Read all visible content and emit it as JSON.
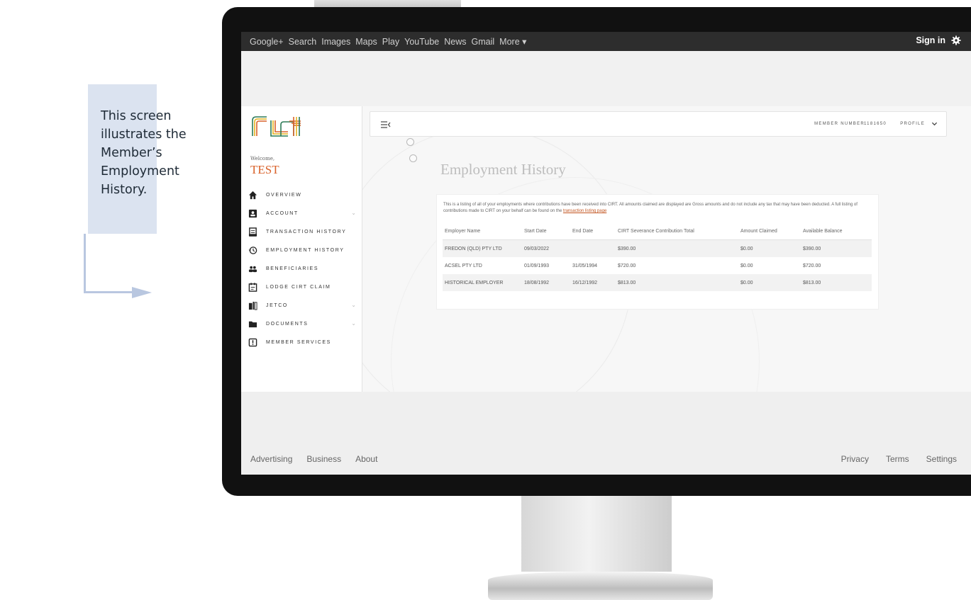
{
  "callout": {
    "text": "This screen illustrates the Member’s Employment History."
  },
  "google_bar": {
    "links": [
      "Google+",
      "Search",
      "Images",
      "Maps",
      "Play",
      "YouTube",
      "News",
      "Gmail",
      "More ▾"
    ],
    "sign_in": "Sign in"
  },
  "sidebar": {
    "welcome": "Welcome,",
    "user_name": "TEST",
    "items": [
      {
        "label": "OVERVIEW",
        "icon": "home-icon"
      },
      {
        "label": "ACCOUNT",
        "icon": "account-icon"
      },
      {
        "label": "TRANSACTION HISTORY",
        "icon": "receipt-icon"
      },
      {
        "label": "EMPLOYMENT HISTORY",
        "icon": "history-icon"
      },
      {
        "label": "BENEFICIARIES",
        "icon": "people-icon"
      },
      {
        "label": "LODGE CIRT CLAIM",
        "icon": "claim-icon"
      },
      {
        "label": "JETCO",
        "icon": "books-icon"
      },
      {
        "label": "DOCUMENTS",
        "icon": "folder-icon"
      },
      {
        "label": "MEMBER SERVICES",
        "icon": "services-icon"
      }
    ]
  },
  "header": {
    "member_label": "MEMBER NUMBER:",
    "member_number": "1181650",
    "profile_label": "PROFILE"
  },
  "main": {
    "title": "Employment History",
    "intro": "This is a listing of all of your employments where contributions have been received into CIRT. All amounts claimed are displayed are Gross amounts and do not include any tax that may have been deducted. A full listing of contributions made to CIRT on your behalf can be found on the",
    "intro_link": "transaction listing page",
    "columns": [
      "Employer Name",
      "Start Date",
      "End Date",
      "CIRT Severance Contribution Total",
      "Amount Claimed",
      "Available Balance"
    ],
    "rows": [
      [
        "FREDON (QLD) PTY LTD",
        "09/03/2022",
        "",
        "$390.00",
        "$0.00",
        "$390.00"
      ],
      [
        "ACSEL PTY LTD",
        "01/09/1993",
        "31/05/1994",
        "$720.00",
        "$0.00",
        "$720.00"
      ],
      [
        "HISTORICAL EMPLOYER",
        "18/08/1992",
        "16/12/1992",
        "$813.00",
        "$0.00",
        "$813.00"
      ]
    ]
  },
  "footer": {
    "left": [
      "Advertising",
      "Business",
      "About"
    ],
    "right": [
      "Privacy",
      "Terms",
      "Settings"
    ]
  },
  "colors": {
    "accent": "#d9622b",
    "callout_bg": "#dbe3f0",
    "google_bar": "#2d2d2d"
  }
}
